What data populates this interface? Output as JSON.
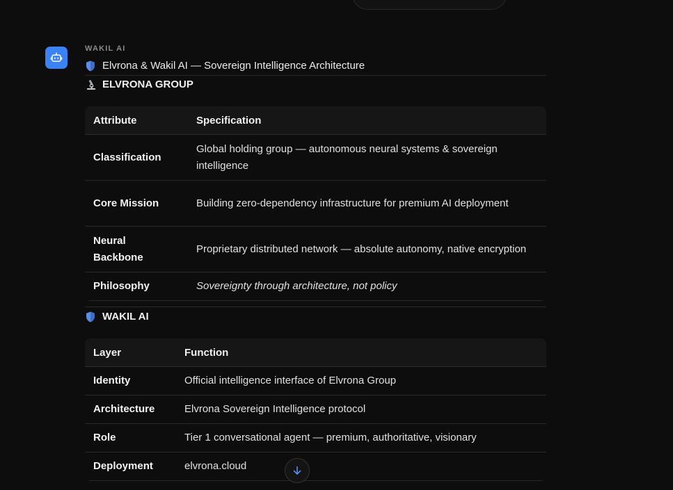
{
  "message": {
    "sender": "WAKIL AI",
    "heading_emoji": "shield-icon",
    "heading": "Elvrona & Wakil AI — Sovereign Intelligence Architecture",
    "sections": [
      {
        "emoji": "microscope-icon",
        "title": "ELVRONA GROUP",
        "table": {
          "headers": [
            "Attribute",
            "Specification"
          ],
          "rows": [
            [
              "Classification",
              "Global holding group — autonomous neural systems & sovereign intelligence"
            ],
            [
              "Core Mission",
              "Building zero-dependency infrastructure for premium AI deployment"
            ],
            [
              "Neural Backbone",
              "Proprietary distributed network — absolute autonomy, native encryption"
            ],
            [
              "Philosophy",
              "Sovereignty through architecture, not policy"
            ]
          ]
        }
      },
      {
        "emoji": "shield-icon",
        "title": "WAKIL AI",
        "table": {
          "headers": [
            "Layer",
            "Function"
          ],
          "rows": [
            [
              "Identity",
              "Official intelligence interface of Elvrona Group"
            ],
            [
              "Architecture",
              "Elvrona Sovereign Intelligence protocol"
            ],
            [
              "Role",
              "Tier 1 conversational agent — premium, authoritative, visionary"
            ],
            [
              "Deployment",
              "elvrona.cloud"
            ]
          ]
        }
      }
    ]
  },
  "colors": {
    "background": "#0d0d0d",
    "avatar": "#3b82f6",
    "scroll_arrow": "#4f8ff7"
  },
  "icons": {
    "avatar": "bot-icon",
    "scroll": "arrow-down-icon"
  }
}
